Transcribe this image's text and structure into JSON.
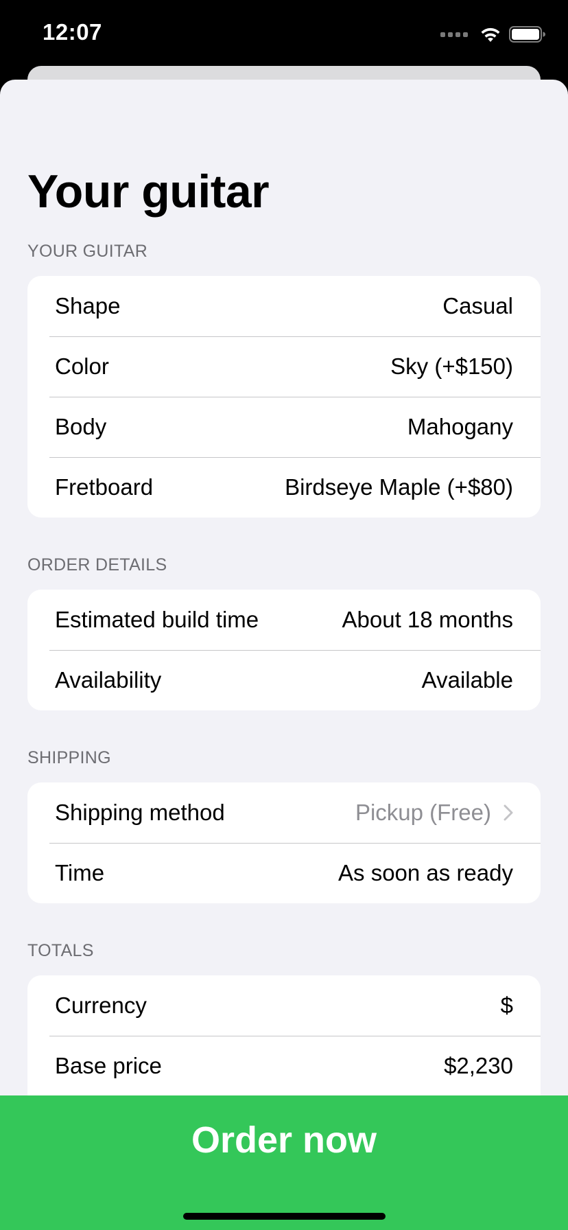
{
  "status_bar": {
    "time": "12:07"
  },
  "page": {
    "title": "Your guitar"
  },
  "sections": {
    "your_guitar": {
      "header": "YOUR GUITAR",
      "rows": [
        {
          "label": "Shape",
          "value": "Casual"
        },
        {
          "label": "Color",
          "value": "Sky (+$150)"
        },
        {
          "label": "Body",
          "value": "Mahogany"
        },
        {
          "label": "Fretboard",
          "value": "Birdseye Maple (+$80)"
        }
      ]
    },
    "order_details": {
      "header": "ORDER DETAILS",
      "rows": [
        {
          "label": "Estimated build time",
          "value": "About 18 months"
        },
        {
          "label": "Availability",
          "value": "Available"
        }
      ]
    },
    "shipping": {
      "header": "SHIPPING",
      "rows": [
        {
          "label": "Shipping method",
          "value": "Pickup (Free)"
        },
        {
          "label": "Time",
          "value": "As soon as ready"
        }
      ]
    },
    "totals": {
      "header": "TOTALS",
      "rows": [
        {
          "label": "Currency",
          "value": "$"
        },
        {
          "label": "Base price",
          "value": "$2,230"
        }
      ]
    }
  },
  "order_button": {
    "label": "Order now"
  },
  "colors": {
    "accent_green": "#34c759",
    "background": "#f2f2f7",
    "secondary_text": "#8e8e93"
  },
  "icons": {
    "status": [
      "cellular-signal-icon",
      "wifi-icon",
      "battery-icon"
    ],
    "disclosure": "chevron-right-icon"
  }
}
